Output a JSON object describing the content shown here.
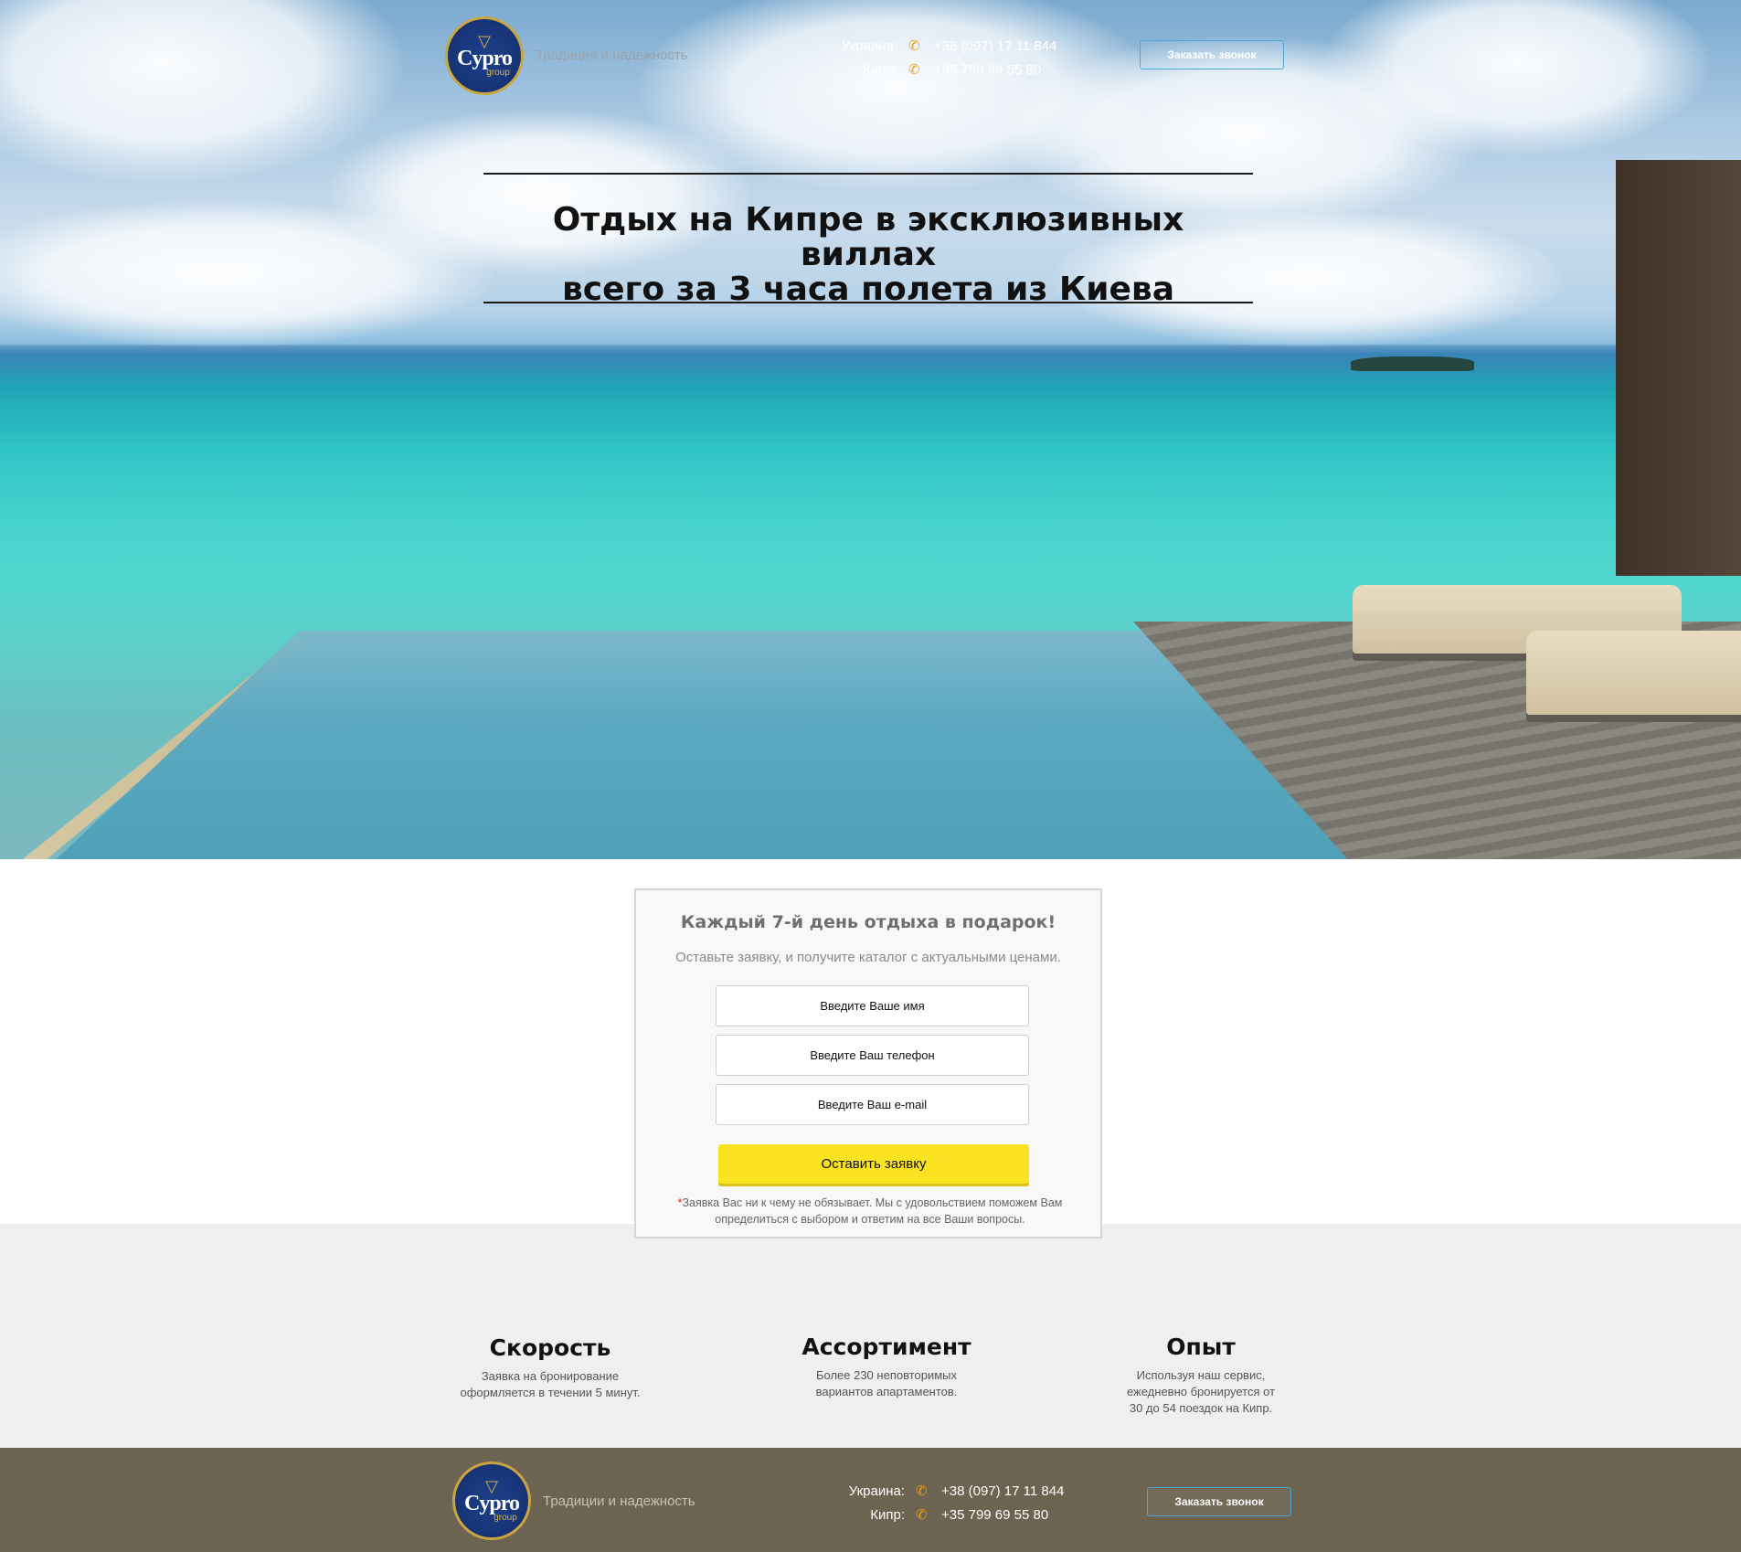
{
  "header": {
    "logo_name": "Cypro",
    "logo_group": "group",
    "tagline": "Традиции и надежность",
    "contacts": [
      {
        "label": "Украина:",
        "phone": "+38 (097) 17 11 844"
      },
      {
        "label": "Кипр:",
        "phone": "+35 799 69 55 80"
      }
    ],
    "call_button": "Заказать звонок"
  },
  "hero": {
    "headline_line1": "Отдых на Кипре в эксклюзивных виллах",
    "headline_line2": "всего за 3 часа полета из Киева"
  },
  "form": {
    "title": "Каждый 7-й день отдыха в подарок!",
    "subtitle": "Оставьте заявку, и получите каталог с актуальными ценами.",
    "name_placeholder": "Введите Ваше имя",
    "phone_placeholder": "Введите Ваш телефон",
    "email_placeholder": "Введите Ваш e-mail",
    "submit_label": "Оставить заявку",
    "note_star": "*",
    "note": "Заявка Вас ни к чему не обязывает. Мы с удовольствием поможем Вам определиться с выбором и ответим на все Ваши вопросы."
  },
  "features": [
    {
      "title": "Скорость",
      "text": "Заявка на бронирование оформляется в течении 5 минут."
    },
    {
      "title": "Ассортимент",
      "text": "Более 230 неповторимых вариантов апартаментов."
    },
    {
      "title": "Опыт",
      "text": "Используя наш сервис, ежедневно бронируется от 30 до 54 поездок на Кипр."
    }
  ],
  "footer": {
    "logo_name": "Cypro",
    "logo_group": "group",
    "tagline": "Традиции и надежность",
    "contacts": [
      {
        "label": "Украина:",
        "phone": "+38 (097) 17 11 844"
      },
      {
        "label": "Кипр:",
        "phone": "+35 799 69 55 80"
      }
    ],
    "call_button": "Заказать звонок"
  },
  "icons": {
    "phone": "phone-icon",
    "logo_mark": "v-mark-icon"
  },
  "colors": {
    "accent_yellow": "#fbe322",
    "logo_blue": "#1b3f8a",
    "logo_gold": "#c9a642",
    "footer_bg": "#6c6350",
    "button_border": "#4aa6d4"
  }
}
